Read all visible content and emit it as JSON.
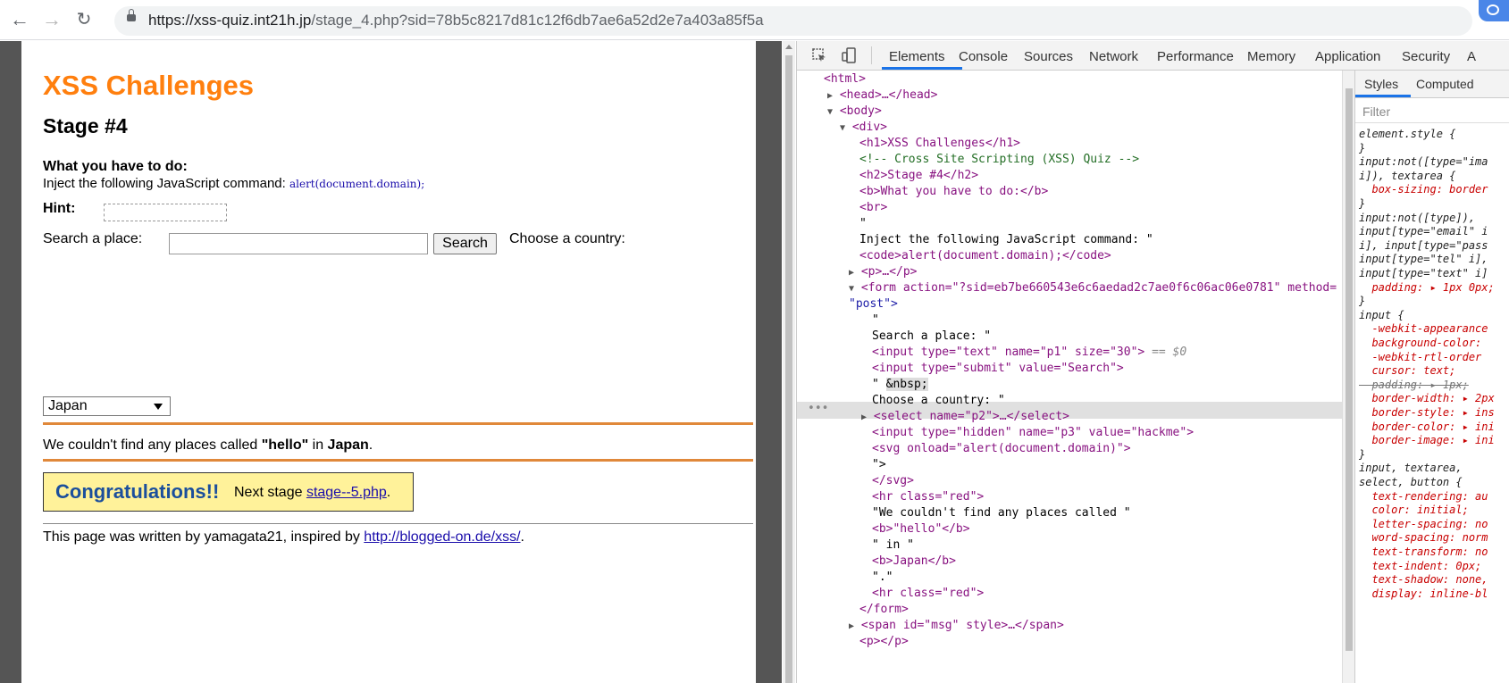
{
  "browser": {
    "url_host": "https://xss-quiz.int21h.jp",
    "url_path": "/stage_4.php?sid=78b5c8217d81c12f6db7ae6a52d2e7a403a85f5a"
  },
  "page": {
    "title": "XSS Challenges",
    "stage": "Stage #4",
    "todo_label": "What you have to do:",
    "inject_text": "Inject the following JavaScript command:",
    "inject_code": "alert(document.domain);",
    "hint_label": "Hint:",
    "search_label": "Search a place:",
    "search_value": "",
    "search_button": "Search",
    "country_label": "Choose a country:",
    "country_selected": "Japan",
    "msg_prefix": "We couldn't find any places called ",
    "msg_query": "\"hello\"",
    "msg_in": " in ",
    "msg_country": "Japan",
    "msg_end": ".",
    "congrats": "Congratulations!!",
    "next_stage_text": "Next stage ",
    "next_stage_link": "stage--5.php",
    "next_stage_end": ".",
    "footer_text": "This page was written by yamagata21, inspired by ",
    "footer_link": "http://blogged-on.de/xss/",
    "footer_end": "."
  },
  "devtools": {
    "tabs": [
      "Elements",
      "Console",
      "Sources",
      "Network",
      "Performance",
      "Memory",
      "Application",
      "Security",
      "A"
    ],
    "active_tab": "Elements",
    "dom": {
      "html_open": "<html>",
      "head": "<head>…</head>",
      "body_open": "<body>",
      "div_open": "<div>",
      "h1": "<h1>XSS Challenges</h1>",
      "comment": "<!-- Cross Site Scripting (XSS) Quiz -->",
      "h2": "<h2>Stage #4</h2>",
      "b_todo": "<b>What you have to do:</b>",
      "br": "<br>",
      "quote1": "\"",
      "inject_line": "Inject the following JavaScript command: \"",
      "code_line": "<code>alert(document.domain);</code>",
      "p_collapsed": "<p>…</p>",
      "form_open": "<form action=\"?sid=eb7be660543e6c6aedad2c7ae0f6c06ac06e0781\" method=",
      "form_method": "\"post\">",
      "quote2": "\"",
      "search_text": "Search a place: \"",
      "input_text": "<input type=\"text\" name=\"p1\" size=\"30\">",
      "selected_marker": "== $0",
      "input_submit": "<input type=\"submit\" value=\"Search\">",
      "nbsp_quote": "\" ",
      "nbsp": "&nbsp;",
      "choose_text": "Choose a country: \"",
      "select_line": "<select name=\"p2\">…</select>",
      "hidden_line": "<input type=\"hidden\" name=\"p3\" value=\"hackme\">",
      "svg_line": "<svg onload=\"alert(document.domain)\">",
      "close_quote": "\">",
      "svg_close": "</svg>",
      "hr_red1": "<hr class=\"red\">",
      "msg_text": "\"We couldn't find any places called \"",
      "b_hello": "<b>\"hello\"</b>",
      "in_text": "\" in \"",
      "b_japan": "<b>Japan</b>",
      "dot_text": "\".\"",
      "hr_red2": "<hr class=\"red\">",
      "form_close": "</form>",
      "span_msg": "<span id=\"msg\" style>…</span>",
      "p_empty": "<p></p>"
    },
    "styles": {
      "tabs": [
        "Styles",
        "Computed"
      ],
      "filter_placeholder": "Filter",
      "lines": [
        {
          "t": "element.style {",
          "k": "sel"
        },
        {
          "t": "}",
          "k": "sel"
        },
        {
          "t": "input:not([type=\"ima",
          "k": "sel"
        },
        {
          "t": "i]), textarea {",
          "k": "sel"
        },
        {
          "t": "  box-sizing: border",
          "k": "prop"
        },
        {
          "t": "}",
          "k": "sel"
        },
        {
          "t": "input:not([type]),",
          "k": "sel"
        },
        {
          "t": "input[type=\"email\" i",
          "k": "sel"
        },
        {
          "t": "i], input[type=\"pass",
          "k": "sel"
        },
        {
          "t": "input[type=\"tel\" i],",
          "k": "sel"
        },
        {
          "t": "input[type=\"text\" i]",
          "k": "sel"
        },
        {
          "t": "  padding: ▸ 1px 0px;",
          "k": "prop"
        },
        {
          "t": "}",
          "k": "sel"
        },
        {
          "t": "input {",
          "k": "sel"
        },
        {
          "t": "  -webkit-appearance",
          "k": "prop"
        },
        {
          "t": "  background-color:",
          "k": "prop"
        },
        {
          "t": "  -webkit-rtl-order",
          "k": "prop"
        },
        {
          "t": "  cursor: text;",
          "k": "prop"
        },
        {
          "t": "  padding: ▸ 1px;",
          "k": "struck"
        },
        {
          "t": "  border-width: ▸ 2px",
          "k": "prop"
        },
        {
          "t": "  border-style: ▸ ins",
          "k": "prop"
        },
        {
          "t": "  border-color: ▸ ini",
          "k": "prop"
        },
        {
          "t": "  border-image: ▸ ini",
          "k": "prop"
        },
        {
          "t": "}",
          "k": "sel"
        },
        {
          "t": "input, textarea,",
          "k": "sel"
        },
        {
          "t": "select, button {",
          "k": "sel"
        },
        {
          "t": "  text-rendering: au",
          "k": "prop"
        },
        {
          "t": "  color: initial;",
          "k": "prop"
        },
        {
          "t": "  letter-spacing: no",
          "k": "prop"
        },
        {
          "t": "  word-spacing: norm",
          "k": "prop"
        },
        {
          "t": "  text-transform: no",
          "k": "prop"
        },
        {
          "t": "  text-indent: 0px;",
          "k": "prop"
        },
        {
          "t": "  text-shadow: none,",
          "k": "prop"
        },
        {
          "t": "  display: inline-bl",
          "k": "prop"
        }
      ]
    }
  }
}
